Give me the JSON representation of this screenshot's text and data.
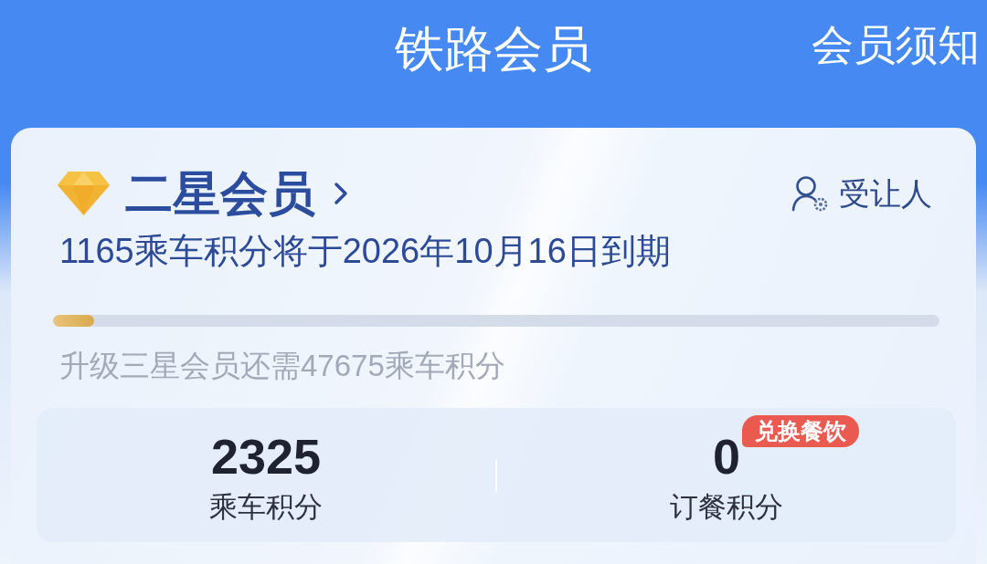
{
  "header": {
    "title": "铁路会员",
    "link": "会员须知"
  },
  "membership": {
    "level_name": "二星会员",
    "transferee": "受让人",
    "expiry_notice": "1165乘车积分将于2026年10月16日到期",
    "progress": {
      "level": 0.046
    },
    "upgrade_hint": "升级三星会员还需47675乘车积分"
  },
  "points": [
    {
      "value": "2325",
      "label": "乘车积分"
    },
    {
      "value": "0",
      "label": "订餐积分",
      "badge": "兑换餐饮"
    }
  ]
}
